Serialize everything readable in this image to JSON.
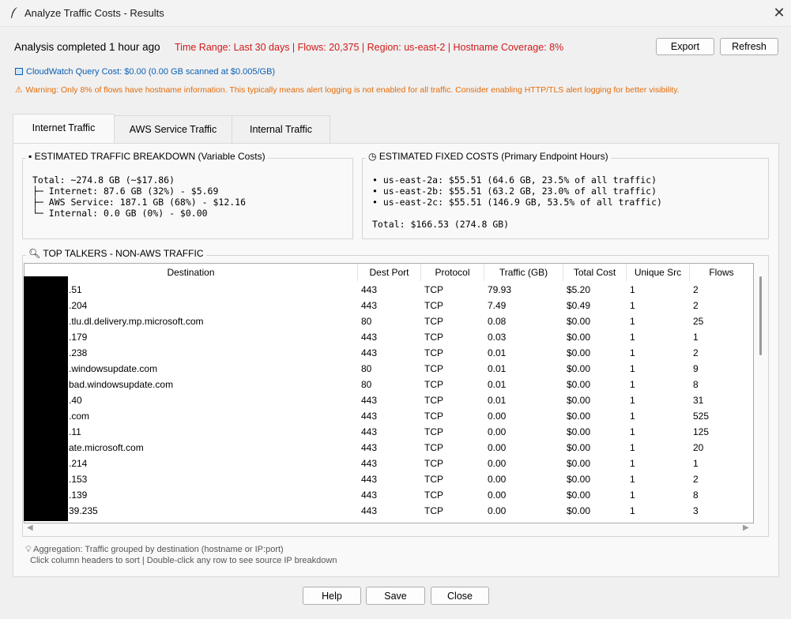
{
  "window": {
    "title": "Analyze Traffic Costs - Results"
  },
  "header": {
    "status": "Analysis completed 1 hour ago",
    "meta": "Time Range: Last 30 days | Flows: 20,375 | Region: us-east-2 | Hostname Coverage: 8%",
    "export_label": "Export",
    "refresh_label": "Refresh",
    "cloudwatch": "CloudWatch Query Cost: $0.00 (0.00 GB scanned at $0.005/GB)",
    "warning": "Warning: Only 8% of flows have hostname information. This typically means alert logging is not enabled for all traffic. Consider enabling HTTP/TLS alert logging for better visibility."
  },
  "tabs": [
    "Internet Traffic",
    "AWS Service Traffic",
    "Internal Traffic"
  ],
  "breakdown": {
    "title": "ESTIMATED TRAFFIC BREAKDOWN (Variable Costs)",
    "lines": [
      "Total: ~274.8 GB (~$17.86)",
      "├─ Internet: 87.6 GB (32%) - $5.69",
      "├─ AWS Service: 187.1 GB (68%) - $12.16",
      "└─ Internal: 0.0 GB (0%) - $0.00"
    ]
  },
  "fixed_costs": {
    "title": "ESTIMATED FIXED COSTS (Primary Endpoint Hours)",
    "lines": [
      "• us-east-2a: $55.51 (64.6 GB, 23.5% of all traffic)",
      "• us-east-2b: $55.51 (63.2 GB, 23.0% of all traffic)",
      "• us-east-2c: $55.51 (146.9 GB, 53.5% of all traffic)"
    ],
    "total": "Total: $166.53 (274.8 GB)"
  },
  "top_talkers": {
    "title": "TOP TALKERS - NON-AWS TRAFFIC",
    "columns": [
      "Destination",
      "Dest Port",
      "Protocol",
      "Traffic (GB)",
      "Total Cost",
      "Unique Src",
      "Flows"
    ],
    "rows": [
      [
        ".51",
        "443",
        "TCP",
        "79.93",
        "$5.20",
        "1",
        "2"
      ],
      [
        ".204",
        "443",
        "TCP",
        "7.49",
        "$0.49",
        "1",
        "2"
      ],
      [
        ".tlu.dl.delivery.mp.microsoft.com",
        "80",
        "TCP",
        "0.08",
        "$0.00",
        "1",
        "25"
      ],
      [
        ".179",
        "443",
        "TCP",
        "0.03",
        "$0.00",
        "1",
        "1"
      ],
      [
        ".238",
        "443",
        "TCP",
        "0.01",
        "$0.00",
        "1",
        "2"
      ],
      [
        ".windowsupdate.com",
        "80",
        "TCP",
        "0.01",
        "$0.00",
        "1",
        "9"
      ],
      [
        "bad.windowsupdate.com",
        "80",
        "TCP",
        "0.01",
        "$0.00",
        "1",
        "8"
      ],
      [
        ".40",
        "443",
        "TCP",
        "0.01",
        "$0.00",
        "1",
        "31"
      ],
      [
        ".com",
        "443",
        "TCP",
        "0.00",
        "$0.00",
        "1",
        "525"
      ],
      [
        ".11",
        "443",
        "TCP",
        "0.00",
        "$0.00",
        "1",
        "125"
      ],
      [
        "ate.microsoft.com",
        "443",
        "TCP",
        "0.00",
        "$0.00",
        "1",
        "20"
      ],
      [
        ".214",
        "443",
        "TCP",
        "0.00",
        "$0.00",
        "1",
        "1"
      ],
      [
        ".153",
        "443",
        "TCP",
        "0.00",
        "$0.00",
        "1",
        "2"
      ],
      [
        ".139",
        "443",
        "TCP",
        "0.00",
        "$0.00",
        "1",
        "8"
      ],
      [
        "39.235",
        "443",
        "TCP",
        "0.00",
        "$0.00",
        "1",
        "3"
      ]
    ]
  },
  "notes": {
    "aggregation": "Aggregation: Traffic grouped by destination (hostname or IP:port)",
    "hint": "Click column headers to sort | Double-click any row to see source IP breakdown"
  },
  "footer": {
    "help_label": "Help",
    "save_label": "Save",
    "close_label": "Close"
  }
}
